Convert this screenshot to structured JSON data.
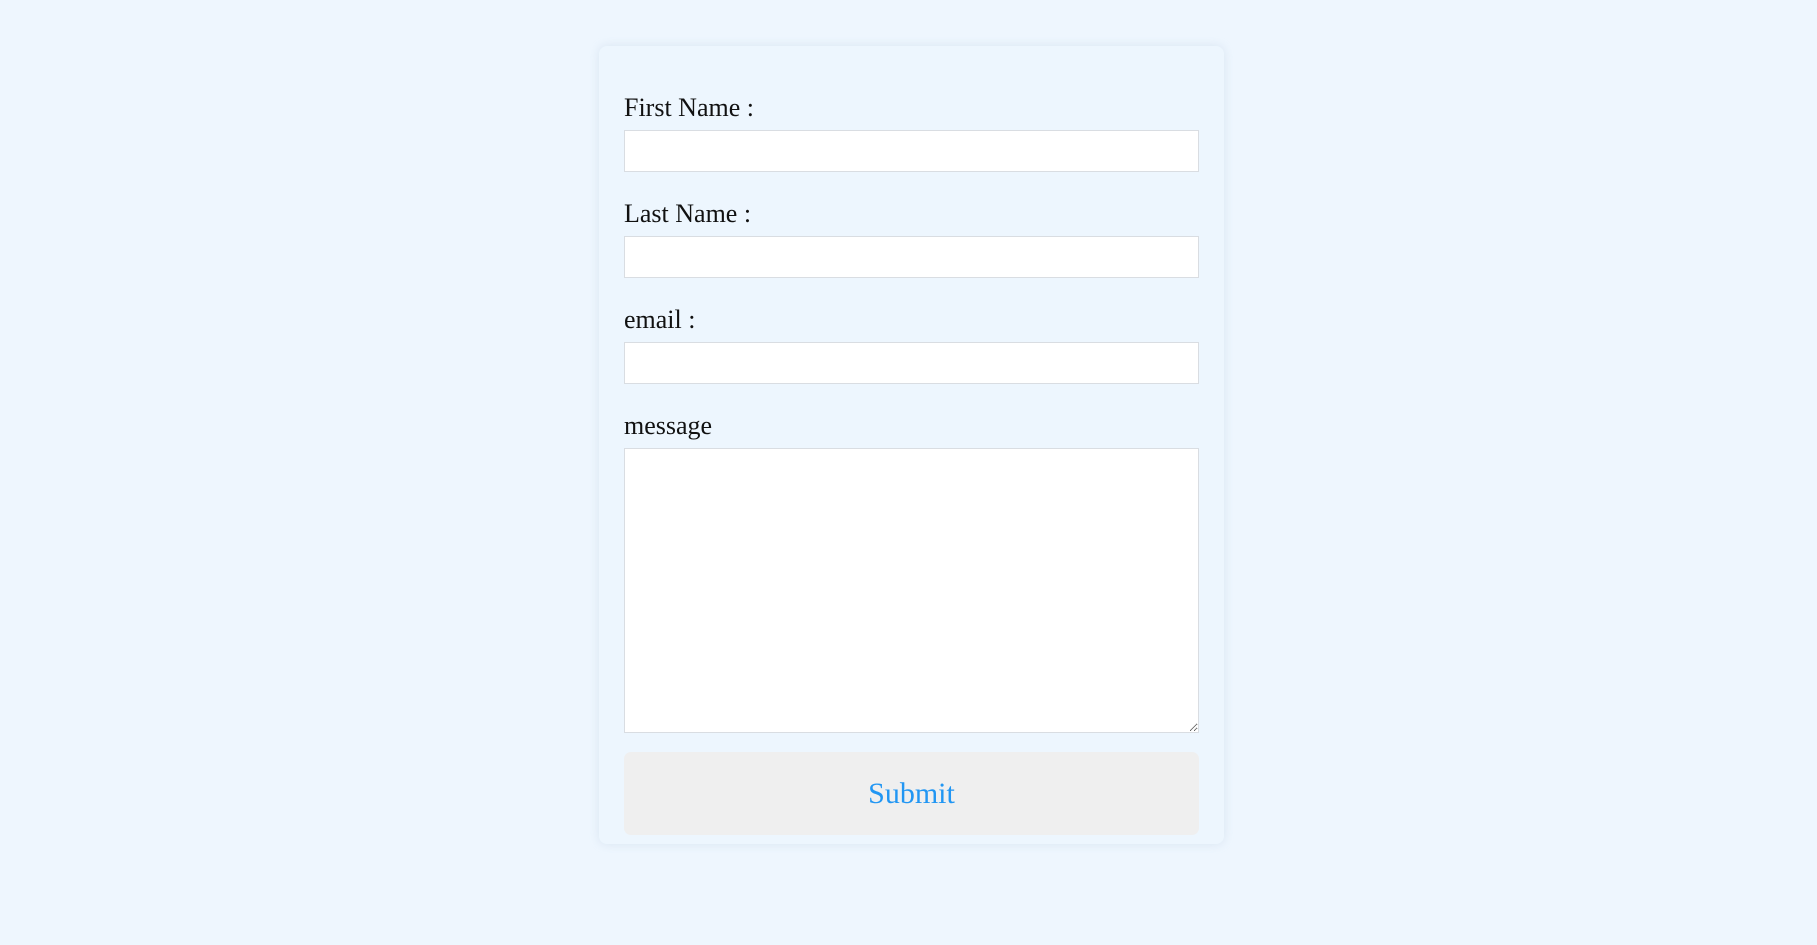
{
  "form": {
    "first_name": {
      "label": "First Name :",
      "value": "",
      "placeholder": ""
    },
    "last_name": {
      "label": "Last Name :",
      "value": "",
      "placeholder": ""
    },
    "email": {
      "label": "email :",
      "value": "",
      "placeholder": ""
    },
    "message": {
      "label": "message",
      "value": "",
      "placeholder": ""
    },
    "submit_label": "Submit"
  },
  "colors": {
    "page_background": "#eef6fe",
    "card_background": "#edf6fe",
    "submit_text": "#2196f3",
    "submit_background": "#efefef"
  }
}
